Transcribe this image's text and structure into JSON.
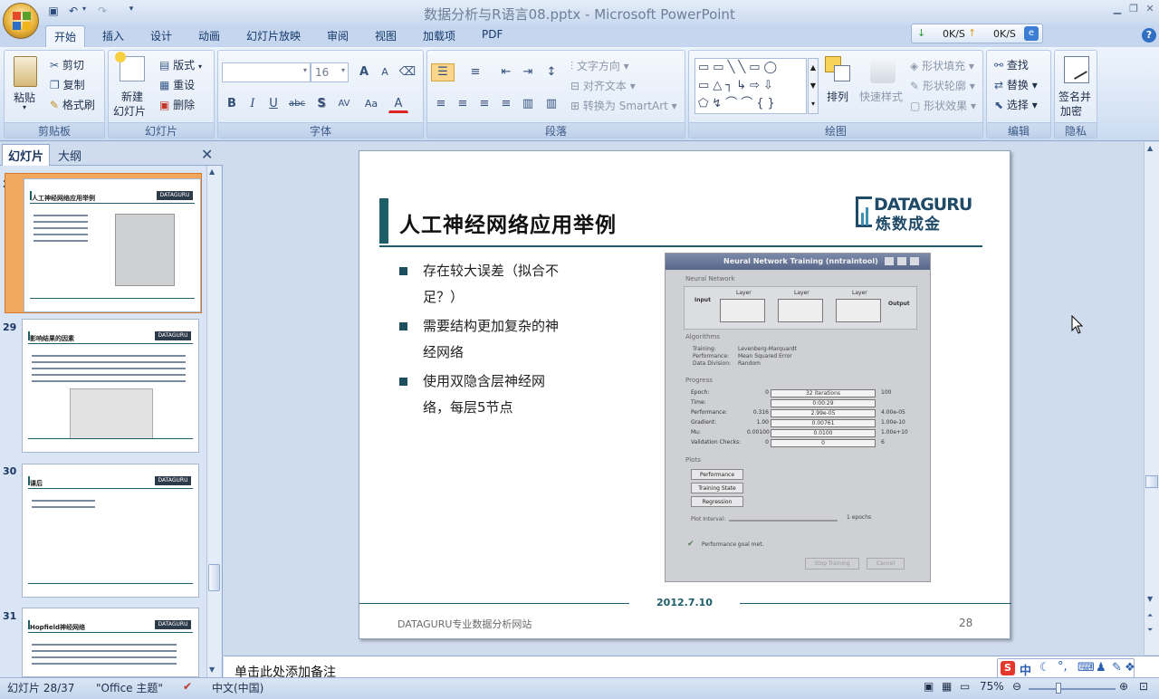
{
  "window": {
    "title": "数据分析与R语言08.pptx - Microsoft PowerPoint"
  },
  "tabs": [
    "开始",
    "插入",
    "设计",
    "动画",
    "幻灯片放映",
    "审阅",
    "视图",
    "加载项",
    "PDF"
  ],
  "network": {
    "down": "0K/S",
    "up": "0K/S"
  },
  "ribbon": {
    "clipboard": {
      "paste": "粘贴",
      "cut": "剪切",
      "copy": "复制",
      "format_painter": "格式刷",
      "label": "剪贴板"
    },
    "slides": {
      "new_slide_1": "新建",
      "new_slide_2": "幻灯片",
      "layout": "版式",
      "reset": "重设",
      "delete": "删除",
      "label": "幻灯片"
    },
    "font": {
      "size": "16",
      "label": "字体",
      "grow": "A",
      "shrink": "A",
      "bold": "B",
      "italic": "I",
      "underline": "U",
      "strike": "abc",
      "shadow": "S",
      "spacing": "AV",
      "case": "Aa",
      "color": "A"
    },
    "paragraph": {
      "text_direction": "文字方向",
      "align_text": "对齐文本",
      "smartart": "转换为 SmartArt",
      "label": "段落"
    },
    "drawing": {
      "arrange": "排列",
      "quick_styles": "快速样式",
      "shape_fill": "形状填充",
      "shape_outline": "形状轮廓",
      "shape_effects": "形状效果",
      "label": "绘图"
    },
    "editing": {
      "find": "查找",
      "replace": "替换",
      "select": "选择",
      "label": "编辑"
    },
    "privacy": {
      "sign_1": "签名并",
      "sign_2": "加密",
      "label": "隐私"
    }
  },
  "left_pane": {
    "tab_slides": "幻灯片",
    "tab_outline": "大纲",
    "thumbs": [
      {
        "num": "28",
        "title": "人工神经网络应用举例"
      },
      {
        "num": "29",
        "title": "影响结果的因素"
      },
      {
        "num": "30",
        "title": "课后"
      },
      {
        "num": "31",
        "title": "Hopfield神经网络"
      }
    ]
  },
  "slide": {
    "title": "人工神经网络应用举例",
    "logo_top": "DATAGURU",
    "logo_bottom": "炼数成金",
    "bullets": [
      "存在较大误差（拟合不足？）",
      "需要结构更加复杂的神经网络",
      "使用双隐含层神经网络，每层5节点"
    ],
    "date": "2012.7.10",
    "footer": "DATAGURU专业数据分析网站",
    "page_number": "28",
    "nn": {
      "window_title": "Neural Network Training (nntraintool)",
      "section_network": "Neural Network",
      "input": "Input",
      "output": "Output",
      "layer": "Layer",
      "section_algorithms": "Algorithms",
      "training_label": "Training:",
      "training_value": "Levenberg-Marquardt",
      "performance_label": "Performance:",
      "performance_value": "Mean Squared Error",
      "division_label": "Data Division:",
      "division_value": "Random",
      "section_progress": "Progress",
      "rows": [
        {
          "label": "Epoch:",
          "min": "0",
          "value": "32 iterations",
          "max": "100"
        },
        {
          "label": "Time:",
          "min": "",
          "value": "0:00:29",
          "max": ""
        },
        {
          "label": "Performance:",
          "min": "0.316",
          "value": "2.99e-05",
          "max": "4.00e-05"
        },
        {
          "label": "Gradient:",
          "min": "1.00",
          "value": "0.00761",
          "max": "1.00e-10"
        },
        {
          "label": "Mu:",
          "min": "0.00100",
          "value": "0.0100",
          "max": "1.00e+10"
        },
        {
          "label": "Validation Checks:",
          "min": "0",
          "value": "0",
          "max": "6"
        }
      ],
      "section_plots": "Plots",
      "plot_buttons": [
        "Performance",
        "Training State",
        "Regression"
      ],
      "plot_interval": "Plot Interval:",
      "plot_epochs": "1 epochs",
      "goal_met": "Performance goal met.",
      "stop": "Stop Training",
      "cancel": "Cancel"
    }
  },
  "notes_placeholder": "单击此处添加备注",
  "status": {
    "slide_info": "幻灯片 28/37",
    "theme": "\"Office 主题\"",
    "language": "中文(中国)",
    "zoom": "75%"
  },
  "ime": {
    "lang": "中"
  }
}
